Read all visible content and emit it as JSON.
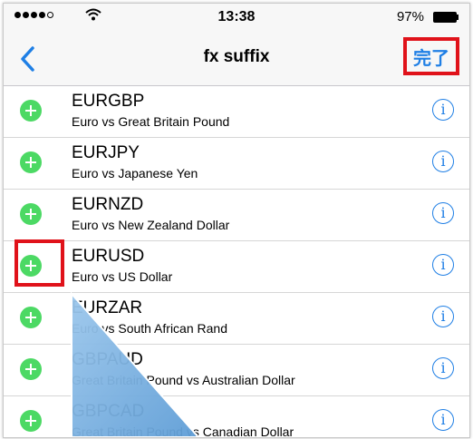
{
  "status_bar": {
    "time": "13:38",
    "battery_percent": "97%",
    "signal_bars_filled": 4,
    "signal_bars_total": 5
  },
  "nav": {
    "title": "fx suffix",
    "done_label": "完了",
    "back_icon": "chevron-left-icon",
    "accent_color": "#1f7fe5"
  },
  "rows": [
    {
      "code": "EURGBP",
      "desc": "Euro vs Great Britain Pound"
    },
    {
      "code": "EURJPY",
      "desc": "Euro vs Japanese Yen"
    },
    {
      "code": "EURNZD",
      "desc": "Euro vs New Zealand Dollar"
    },
    {
      "code": "EURUSD",
      "desc": "Euro vs US Dollar"
    },
    {
      "code": "EURZAR",
      "desc": "Euro vs South African Rand"
    },
    {
      "code": "GBPAUD",
      "desc": "Great Britain Pound vs Australian Dollar"
    },
    {
      "code": "GBPCAD",
      "desc": "Great Britain Pound vs Canadian Dollar"
    }
  ],
  "icons": {
    "add": "plus-circle-icon",
    "info": "info-circle-icon",
    "info_glyph": "i"
  },
  "colors": {
    "add_green": "#4cd964",
    "highlight_red": "#e0121a"
  }
}
